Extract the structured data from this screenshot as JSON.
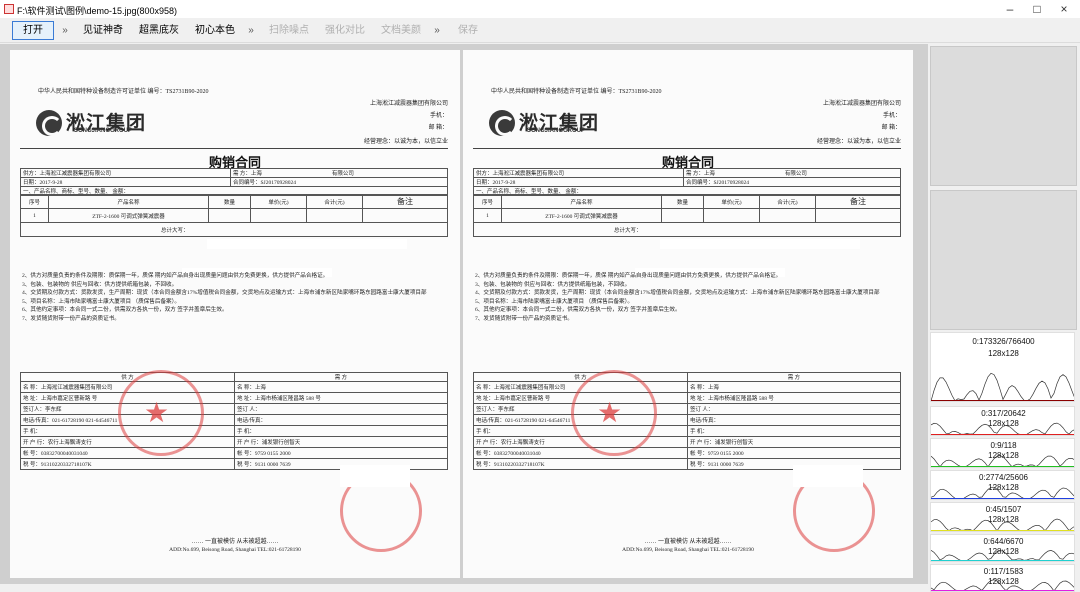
{
  "window": {
    "title": "F:\\软件测试\\图例\\demo-15.jpg(800x958)",
    "minimize": "–",
    "maximize": "□",
    "close": "×"
  },
  "toolbar": {
    "open": "打开",
    "more1": "»",
    "b1": "见证神奇",
    "b2": "超黑底灰",
    "b3": "初心本色",
    "more2": "»",
    "d1": "扫除噪点",
    "d2": "强化对比",
    "d3": "文档美颜",
    "more3": "»",
    "save": "保存"
  },
  "document": {
    "header_left": "中华人民共和国特种设备制造许可证单位 编号：TS2731B90-2020",
    "company_cn": "淞江集团",
    "company_en": "SONGJIANGGROUP",
    "header_right": [
      "上海淞江减震器集团有限公司",
      "手机：",
      "邮 箱："
    ],
    "motto": "经营理念：以诚为本，以信立业",
    "title": "购销合同",
    "supplier": "供方：上海淞江减震器集团有限公司",
    "demander_label": "需 方：上海",
    "demander_suffix": "有限公司",
    "date": "日期：2017-9-28",
    "contract_no": "合同编号：SJ20170928024",
    "section1": "一、产品名称、商标、型号、数量、 金额：",
    "cols": [
      "序号",
      "产品名称",
      "数量",
      "单价(元)",
      "合计(元)",
      "备注"
    ],
    "row1": [
      "1",
      "ZTF-2-1600 可调式弹簧减震器"
    ],
    "total": "总计大写：",
    "terms": [
      "2、供方对质量负责的条件及期限：质保期一年，质保 期内如产品自身出现质量问题由供方免费更换，供方提供产品合格证。",
      "3、包装、包装物的 供应与回收：供方提供纸箱包装，不回收。",
      "4、交货期及付款方式：货款发货，生产周期：现货（本合同金额含17%增值税合同金额，交货地点及运输方式：上海市浦东新区陆家嘴环路东园路富士康大厦项目部",
      "5、项目名称：上海市陆家嘴富士康大厦项目 （质保售后备案）。",
      "6、其他约定事项：本合同一式二份，供需双方各执一份，双方 签字并盖章后生效。",
      "7、发货随货附带一份产品的资质证书。"
    ],
    "party_sup": "供 方",
    "party_dem": "需 方",
    "sup_rows": [
      "名 称：上海淞江减震器集团有限公司",
      "地 址：上海市嘉定区曹新路 号",
      "签订人：李东辉",
      "电话/传真：021-61728190 021-64546711",
      "手 机：",
      "开 户 行：农行上海飘涛支行",
      "帐 号：03832700040031040",
      "税 号：91310220332718107K"
    ],
    "dem_rows": [
      "名 称：上海",
      "地 址：上海市杨浦区隆昌路 588 号",
      "签订 人：",
      "电话/传真：",
      "手 机：",
      "开 户 行：浦发银行创智天",
      "帐 号：9759 0155 2000",
      "税 号：9131 0000 7639"
    ],
    "dem_name_suffix": "有限公司",
    "footer1": "…… 一直被模仿 从未被超越……",
    "footer2": "ADD:No.699, Beisong Road, Shanghai TEL:021-61728190"
  },
  "histograms": [
    {
      "stat": "0:173326/766400",
      "size": "128x128",
      "color": "#8b0000"
    },
    {
      "stat": "0:317/20642",
      "size": "128x128",
      "color": "#e02020"
    },
    {
      "stat": "0:9/118",
      "size": "128x128",
      "color": "#20c020"
    },
    {
      "stat": "0:2774/25606",
      "size": "128x128",
      "color": "#2040e0"
    },
    {
      "stat": "0:45/1507",
      "size": "128x128",
      "color": "#e0e020"
    },
    {
      "stat": "0:644/6670",
      "size": "128x128",
      "color": "#20d0d0"
    },
    {
      "stat": "0:117/1583",
      "size": "128x128",
      "color": "#e020e0"
    }
  ]
}
